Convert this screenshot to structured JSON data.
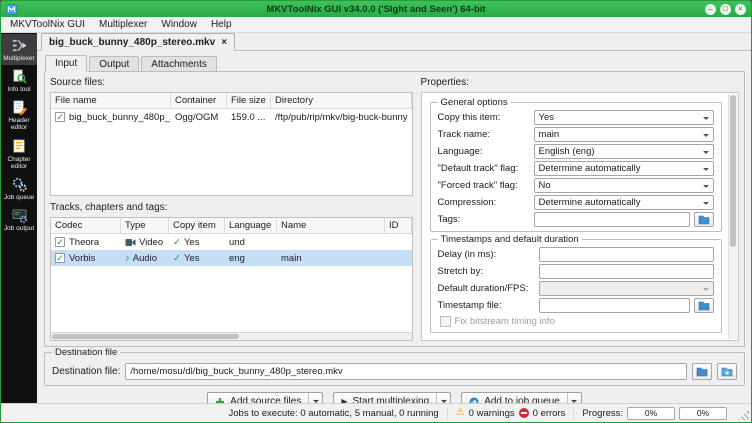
{
  "window": {
    "title": "MKVToolNix GUI v34.0.0 ('Sight and Seen') 64-bit"
  },
  "menu": {
    "items": [
      {
        "label": "MKVToolNix GUI"
      },
      {
        "label": "Multiplexer"
      },
      {
        "label": "Window"
      },
      {
        "label": "Help"
      }
    ]
  },
  "sidebar": {
    "items": [
      {
        "label": "Multiplexer"
      },
      {
        "label": "Info tool"
      },
      {
        "label": "Header editor"
      },
      {
        "label": "Chapter editor"
      },
      {
        "label": "Job queue"
      },
      {
        "label": "Job output"
      }
    ]
  },
  "doc_tab": {
    "label": "big_buck_bunny_480p_stereo.mkv"
  },
  "tabs": {
    "items": [
      {
        "label": "Input"
      },
      {
        "label": "Output"
      },
      {
        "label": "Attachments"
      }
    ]
  },
  "source_files": {
    "label": "Source files:",
    "headers": {
      "file_name": "File name",
      "container": "Container",
      "file_size": "File size",
      "directory": "Directory"
    },
    "row": {
      "file_name": "big_buck_bunny_480p_...",
      "container": "Ogg/OGM",
      "file_size": "159.0 ...",
      "directory": "/ftp/pub/rip/mkv/big-buck-bunny"
    }
  },
  "tracks": {
    "label": "Tracks, chapters and tags:",
    "headers": {
      "codec": "Codec",
      "type": "Type",
      "copy_item": "Copy item",
      "language": "Language",
      "name": "Name",
      "id": "ID"
    },
    "rows": [
      {
        "codec": "Theora",
        "type": "Video",
        "copy_item": "Yes",
        "language": "und",
        "name": ""
      },
      {
        "codec": "Vorbis",
        "type": "Audio",
        "copy_item": "Yes",
        "language": "eng",
        "name": "main"
      }
    ]
  },
  "properties": {
    "label": "Properties:",
    "general": {
      "title": "General options",
      "copy_this_item_label": "Copy this item:",
      "copy_this_item_value": "Yes",
      "track_name_label": "Track name:",
      "track_name_value": "main",
      "language_label": "Language:",
      "language_value": "English (eng)",
      "default_track_flag_label": "\"Default track\" flag:",
      "default_track_flag_value": "Determine automatically",
      "forced_track_flag_label": "\"Forced track\" flag:",
      "forced_track_flag_value": "No",
      "compression_label": "Compression:",
      "compression_value": "Determine automatically",
      "tags_label": "Tags:",
      "tags_value": ""
    },
    "timestamps": {
      "title": "Timestamps and default duration",
      "delay_label": "Delay (in ms):",
      "delay_value": "",
      "stretch_label": "Stretch by:",
      "stretch_value": "",
      "default_duration_label": "Default duration/FPS:",
      "default_duration_value": "",
      "timestamp_file_label": "Timestamp file:",
      "timestamp_file_value": "",
      "fix_bitstream_label": "Fix bitstream timing info"
    }
  },
  "destination": {
    "group_title": "Destination file",
    "field_label": "Destination file:",
    "value": "/home/mosu/dl/big_buck_bunny_480p_stereo.mkv"
  },
  "actions": {
    "add_source_files": "Add source files",
    "start_multiplexing": "Start multiplexing",
    "add_to_job_queue": "Add to job queue"
  },
  "statusbar": {
    "jobs_text": "Jobs to execute: 0 automatic, 5 manual, 0 running",
    "warnings_text": "0 warnings",
    "errors_text": "0 errors",
    "progress_label": "Progress:",
    "progress_current": "0%",
    "progress_total": "0%"
  },
  "icons": {
    "check": "✓",
    "close": "×",
    "minimize": "–",
    "maximize": "□",
    "play": "▶",
    "warning": "⚠",
    "note": "♪"
  }
}
